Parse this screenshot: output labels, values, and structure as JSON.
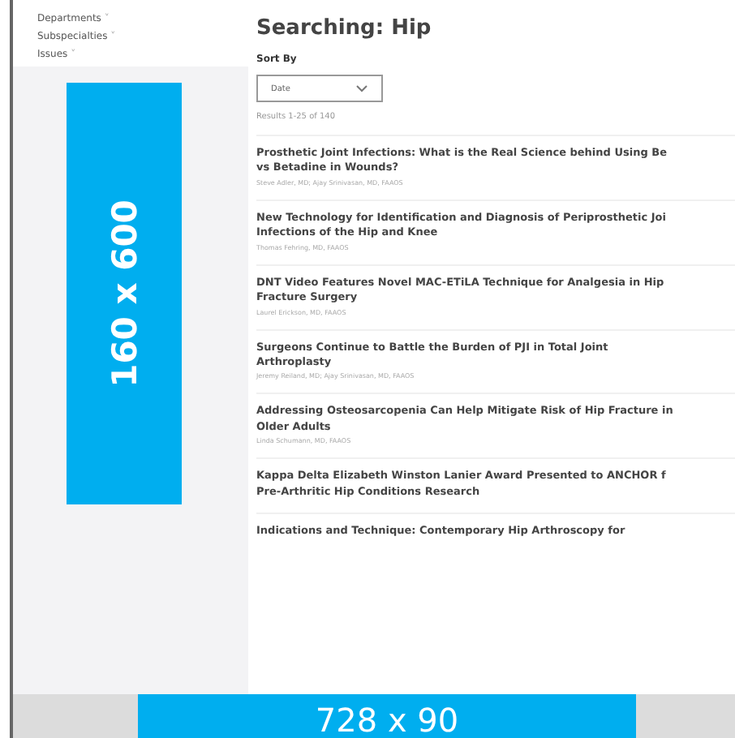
{
  "sidebar": {
    "menu": [
      {
        "label": "Departments",
        "caret": "˅"
      },
      {
        "label": "Subspecialties",
        "caret": "˅"
      },
      {
        "label": "Issues",
        "caret": "˅"
      }
    ],
    "ad": {
      "label": "160 x 600"
    }
  },
  "search": {
    "title": "Searching: Hip",
    "sort_label": "Sort By",
    "sort_value": "Date",
    "results_count": "Results 1-25 of 140"
  },
  "results": [
    {
      "title": "Prosthetic Joint Infections: What is the Real Science behind Using Be",
      "title_2": "vs Betadine in Wounds?",
      "byline": "Steve Adler, MD; Ajay Srinivasan, MD, FAAOS"
    },
    {
      "title": "New Technology for Identification and Diagnosis of Periprosthetic Joi",
      "title_2": "Infections of the Hip and Knee",
      "byline": "Thomas Fehring, MD, FAAOS"
    },
    {
      "title": "DNT Video Features Novel MAC-ETiLA Technique for Analgesia in Hip",
      "title_2": "Fracture Surgery",
      "byline": "Laurel Erickson, MD, FAAOS"
    },
    {
      "title": "Surgeons Continue to Battle the Burden of PJI in Total Joint",
      "title_2": "Arthroplasty",
      "byline": "Jeremy Reiland, MD; Ajay Srinivasan, MD, FAAOS"
    },
    {
      "title": "Addressing Osteosarcopenia Can Help Mitigate Risk of Hip Fracture in",
      "title_2": "Older Adults",
      "byline": "Linda Schumann, MD, FAAOS"
    },
    {
      "title": "Kappa Delta Elizabeth Winston Lanier Award Presented to ANCHOR f",
      "title_2": "Pre-Arthritic Hip Conditions Research"
    },
    {
      "title": "Indications and Technique: Contemporary Hip Arthroscopy for"
    }
  ],
  "bottom_ad": {
    "label": "728 x 90"
  }
}
